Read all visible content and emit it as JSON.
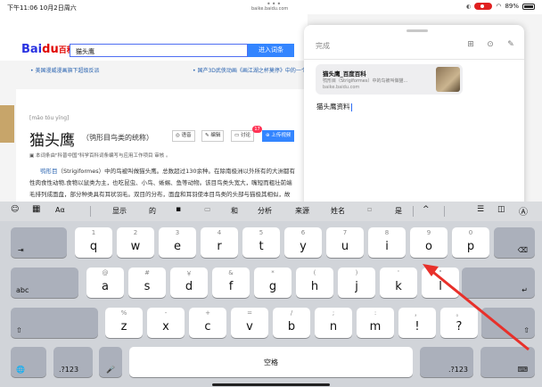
{
  "status": {
    "time": "下午11:06  10月2日周六",
    "url": "baike.baidu.com",
    "battery": "89%"
  },
  "baidu": {
    "logo_a": "Bai",
    "logo_du": "du",
    "logo_bk": "百科",
    "search_value": "猫头鹰",
    "search_button": "进入词条",
    "news1": "• 美国漫威漫画旗下超级反派",
    "news2": "• 国产3D武侠动画《画江湖之杯莫停》中的一个角色"
  },
  "article": {
    "pinyin": "[māo tóu yīng]",
    "title": "猫头鹰",
    "subtitle": "（鸮形目鸟类的统称）",
    "btn_voice": "语音",
    "btn_edit": "编辑",
    "btn_discuss": "讨论",
    "discuss_count": "17",
    "btn_upload": "上传视频",
    "note": "本词条由\"科普中国\"科学百科词条编写与应用工作项目 审核 。",
    "p1_link": "鸮形目",
    "p1": "（Strigiformes）中的鸟被叫做猫头鹰。总数超过130余种。在除南极洲以外所有的大洲都有",
    "p2": "性肉食性动物,食物以鼠类为主，也吃昆虫、小鸟、蜥蜴、鱼等动物。该目鸟类头宽大，嘴短而粗壮前端",
    "p3": "毛排列成面盘，部分种类具有耳状羽毛。双目的分布，面盘和耳羽使本目鸟类的头部与猫极其相似，故"
  },
  "notes": {
    "done": "完成",
    "card_title": "猫头鹰_百度百科",
    "card_desc": "鸮形目（Strigiformes）中的鸟被叫做猫...",
    "card_url": "baike.baidu.com",
    "text": "猫头鹰资料"
  },
  "suggestions": [
    "显示",
    "的",
    "和",
    "分析",
    "来源",
    "姓名",
    "是"
  ],
  "keyboard": {
    "row1": [
      {
        "s": "1",
        "m": "q"
      },
      {
        "s": "2",
        "m": "w"
      },
      {
        "s": "3",
        "m": "e"
      },
      {
        "s": "4",
        "m": "r"
      },
      {
        "s": "5",
        "m": "t"
      },
      {
        "s": "6",
        "m": "y"
      },
      {
        "s": "7",
        "m": "u"
      },
      {
        "s": "8",
        "m": "i"
      },
      {
        "s": "9",
        "m": "o"
      },
      {
        "s": "0",
        "m": "p"
      }
    ],
    "row2": [
      {
        "s": "@",
        "m": "a"
      },
      {
        "s": "#",
        "m": "s"
      },
      {
        "s": "￥",
        "m": "d"
      },
      {
        "s": "&",
        "m": "f"
      },
      {
        "s": "*",
        "m": "g"
      },
      {
        "s": "(",
        "m": "h"
      },
      {
        "s": ")",
        "m": "j"
      },
      {
        "s": "'",
        "m": "k"
      },
      {
        "s": "\"",
        "m": "l"
      }
    ],
    "row3": [
      {
        "s": "%",
        "m": "z"
      },
      {
        "s": "-",
        "m": "x"
      },
      {
        "s": "+",
        "m": "c"
      },
      {
        "s": "=",
        "m": "v"
      },
      {
        "s": "/",
        "m": "b"
      },
      {
        "s": ";",
        "m": "n"
      },
      {
        "s": ":",
        "m": "m"
      },
      {
        "s": "，",
        "m": "!"
      },
      {
        "s": "。",
        "m": "?"
      }
    ],
    "tab": "⇥",
    "delete": "⌫",
    "caps": "abc",
    "return": "↵",
    "shift": "⇧",
    "globe": "🌐",
    "num": ".?123",
    "mic": "🎤",
    "space": "空格",
    "hide": "⌨",
    "toolbar_aa": "Aα"
  },
  "colors": {
    "accent": "#3385ff",
    "arrow": "#e8302a",
    "record": "#e02020"
  }
}
